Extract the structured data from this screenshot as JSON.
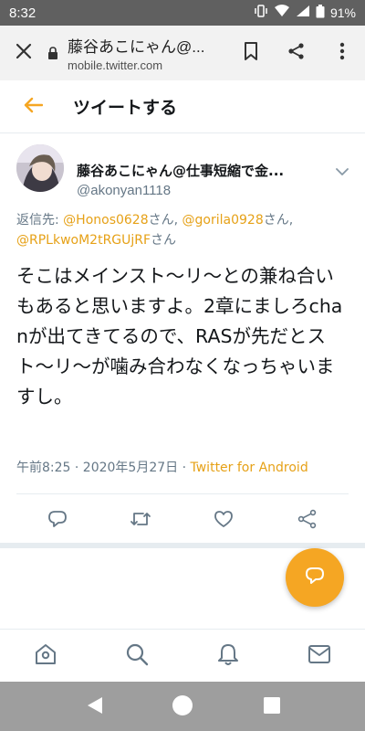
{
  "status_bar": {
    "time": "8:32",
    "battery_text": "91%"
  },
  "browser_bar": {
    "page_title": "藤谷あこにゃん@...",
    "url": "mobile.twitter.com",
    "icons": [
      "close-icon",
      "lock-icon",
      "bookmark-icon",
      "share-icon",
      "more-vert-icon"
    ]
  },
  "header": {
    "title": "ツイートする",
    "back_icon": "arrow-left-icon"
  },
  "tweet": {
    "display_name": "藤谷あこにゃん@仕事短縮で金...",
    "username": "@akonyan1118",
    "reply_prefix": "返信先: ",
    "mention_1": "@Honos0628",
    "san_1": "さん, ",
    "mention_2": "@gorila0928",
    "san_2": "さん, ",
    "mention_3": "@RPLkwoM2tRGUjRF",
    "san_3": "さん",
    "text": "そこはメインスト〜リ〜との兼ね合いもあると思いますよ。2章にましろchanが出てきてるので、RASが先だとスト〜リ〜が噛み合わなくなっちゃいますし。",
    "timestamp": "午前8:25 · 2020年5月27日 · ",
    "source": "Twitter for Android"
  },
  "actions": [
    "reply-icon",
    "retweet-icon",
    "like-icon",
    "share-icon"
  ],
  "bottom_nav": [
    "home-icon",
    "search-icon",
    "notifications-icon",
    "messages-icon"
  ],
  "colors": {
    "accent": "#f5a623",
    "link": "#e6a117",
    "secondary_text": "#657786"
  }
}
